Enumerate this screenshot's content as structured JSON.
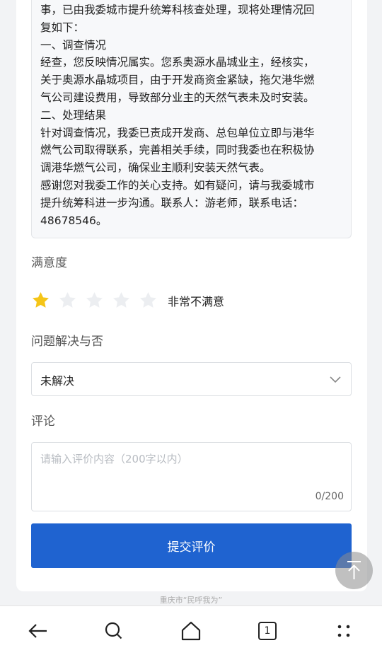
{
  "reply": {
    "lines": [
      "事，已由我委城市提升统筹科核查处理，现将处理情况回",
      "复如下：",
      "一、调查情况",
      "经查，您反映情况属实。您系奥源水晶城业主，经核实，",
      "关于奥源水晶城项目，由于开发商资金紧缺，拖欠港华燃",
      "气公司建设费用，导致部分业主的天然气表未及时安装。",
      "二、处理结果",
      "针对调查情况，我委已责成开发商、总包单位立即与港华",
      "燃气公司取得联系，完善相关手续，同时我委也在积极协",
      "调港华燃气公司，确保业主顺利安装天然气表。",
      "感谢您对我委工作的关心支持。如有疑问，请与我委城市",
      "提升统筹科进一步沟通。联系人：游老师，联系电话：",
      "48678546。"
    ]
  },
  "satisfaction": {
    "title": "满意度",
    "rating": 1,
    "max": 5,
    "rating_text": "非常不满意",
    "star_active_color": "#f5c518",
    "star_inactive_color": "#eceef1"
  },
  "resolved": {
    "title": "问题解决与否",
    "selected": "未解决"
  },
  "comment": {
    "title": "评论",
    "placeholder": "请输入评价内容（200字以内）",
    "counter": "0/200"
  },
  "submit_label": "提交评价",
  "footer_text": "重庆市“民呼我为”",
  "browser_nav": {
    "tab_count": "1",
    "icons": [
      "back-arrow-icon",
      "search-icon",
      "home-icon",
      "tabs-icon",
      "more-icon"
    ]
  },
  "colors": {
    "primary": "#1f63d0"
  }
}
